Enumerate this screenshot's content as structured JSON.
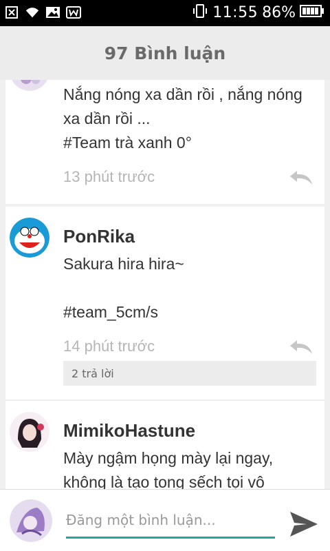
{
  "status_bar": {
    "time": "11:55",
    "battery": "86%",
    "icons": [
      "close-box-icon",
      "wifi-icon",
      "image-icon",
      "w-app-icon",
      "vibrate-icon",
      "battery-icon"
    ]
  },
  "header": {
    "title": "97 Bình luận"
  },
  "comments": [
    {
      "name": "",
      "lines": [
        "Nắng nóng xa dần rồi , nắng nóng",
        "xa dần rồi ...",
        "#Team trà xanh 0°"
      ],
      "time": "13 phút trước"
    },
    {
      "name": "PonRika",
      "lines": [
        "Sakura hira hira~",
        "",
        "#team_5cm/s"
      ],
      "time": "14 phút trước",
      "replies": "2 trả lời"
    },
    {
      "name": "MimikoHastune",
      "lines": [
        "Mày ngậm họng mày lại ngay,",
        "không là tạo tong sếch tọi vô"
      ],
      "time": ""
    }
  ],
  "composer": {
    "placeholder": "Đăng một bình luận..."
  },
  "colors": {
    "accent": "#26a69a",
    "header_bg": "#ececec",
    "muted": "#b5b5b5"
  }
}
